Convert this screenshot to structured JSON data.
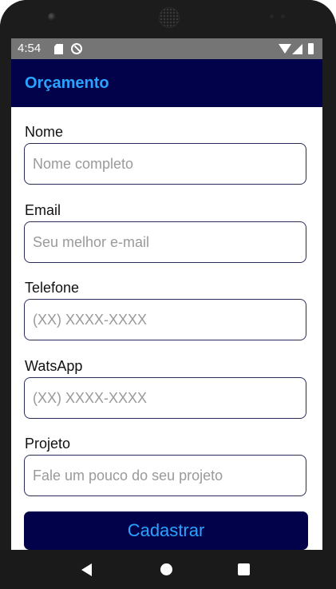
{
  "status_bar": {
    "time": "4:54",
    "icons": [
      "sd-card-icon",
      "sync-icon",
      "wifi-icon",
      "signal-icon",
      "battery-icon"
    ]
  },
  "app_bar": {
    "title": "Orçamento"
  },
  "form": {
    "fields": [
      {
        "label": "Nome",
        "placeholder": "Nome completo",
        "value": ""
      },
      {
        "label": "Email",
        "placeholder": "Seu melhor e-mail",
        "value": ""
      },
      {
        "label": "Telefone",
        "placeholder": "(XX) XXXX-XXXX",
        "value": ""
      },
      {
        "label": "WatsApp",
        "placeholder": "(XX) XXXX-XXXX",
        "value": ""
      },
      {
        "label": "Projeto",
        "placeholder": "Fale um pouco do seu projeto",
        "value": ""
      }
    ],
    "submit_label": "Cadastrar"
  },
  "nav_bar": {
    "icons": [
      "back-icon",
      "home-icon",
      "recents-icon"
    ]
  },
  "colors": {
    "app_bar_bg": "#02024a",
    "accent_text": "#29a3ff",
    "status_bar_bg": "#757575",
    "input_border": "#2c2c5a"
  }
}
